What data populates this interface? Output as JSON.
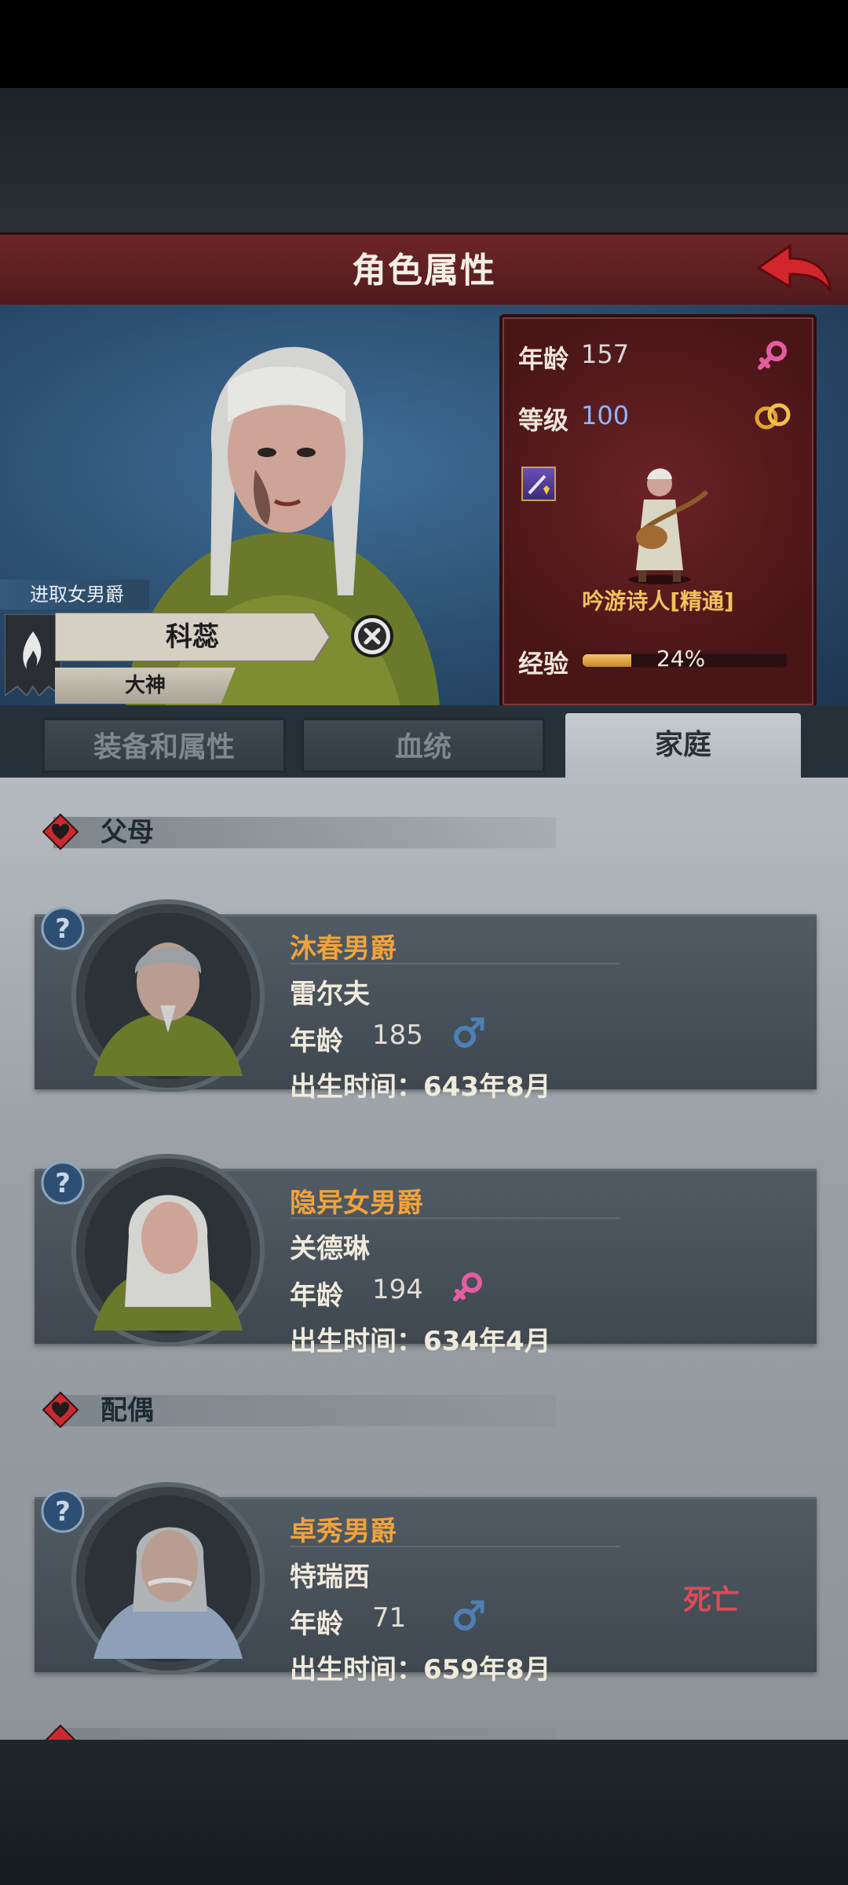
{
  "header": {
    "title": "角色属性"
  },
  "character": {
    "title": "进取女男爵",
    "name": "科蕊",
    "rank": "大神"
  },
  "stats": {
    "age_label": "年龄",
    "age_value": "157",
    "level_label": "等级",
    "level_value": "100",
    "class_name": "吟游诗人[精通]",
    "exp_label": "经验",
    "exp_value": "24%",
    "exp_fraction": 0.24,
    "gender_icon": "female-symbol-icon",
    "relationship_icon": "rings-icon"
  },
  "tabs": [
    {
      "label": "装备和属性",
      "active": false
    },
    {
      "label": "血统",
      "active": false
    },
    {
      "label": "家庭",
      "active": true
    }
  ],
  "sections": {
    "parents": {
      "label": "父母",
      "members": [
        {
          "title": "沐春男爵",
          "name": "雷尔夫",
          "age_label": "年龄",
          "age": "185",
          "gender": "male",
          "birth": "出生时间：643年8月"
        },
        {
          "title": "隐异女男爵",
          "name": "关德琳",
          "age_label": "年龄",
          "age": "194",
          "gender": "female",
          "birth": "出生时间：634年4月"
        }
      ]
    },
    "spouse": {
      "label": "配偶",
      "members": [
        {
          "title": "卓秀男爵",
          "name": "特瑞西",
          "age_label": "年龄",
          "age": "71",
          "gender": "male",
          "birth": "出生时间：659年8月",
          "status": "死亡"
        }
      ]
    }
  },
  "colors": {
    "header_red": "#6e2528",
    "title_orange": "#f0a33c",
    "dead_red": "#e04b55",
    "female_pink": "#e45da0",
    "male_blue": "#4d7fb5"
  }
}
